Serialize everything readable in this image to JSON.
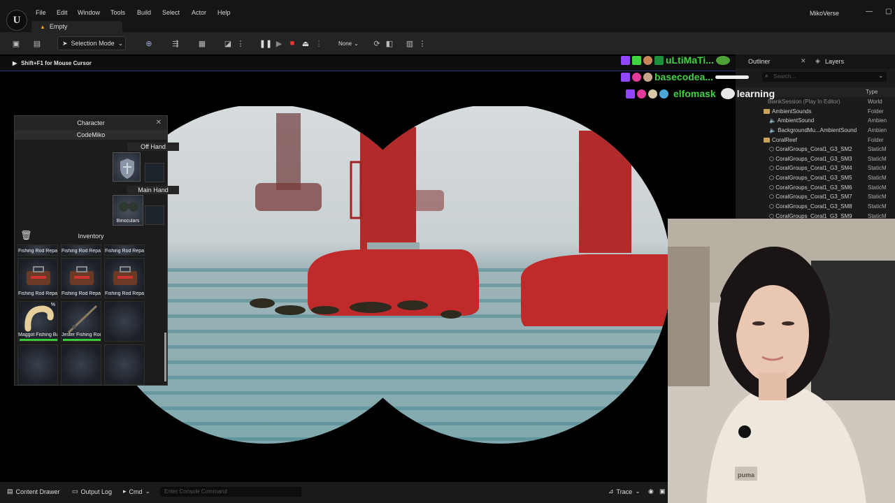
{
  "menu": [
    "File",
    "Edit",
    "Window",
    "Tools",
    "Build",
    "Select",
    "Actor",
    "Help"
  ],
  "project_tab": "Empty",
  "app_name": "MikoVerse",
  "toolbar": {
    "selection_mode": "Selection Mode",
    "play_target": "None"
  },
  "hint": "Shift+F1 for Mouse Cursor",
  "character_panel": {
    "title": "Character",
    "name": "CodeMiko",
    "off_hand": "Off Hand",
    "main_hand": "Main Hand",
    "main_hand_item": "Binoculars",
    "inventory_title": "Inventory",
    "inventory": [
      "Fishing Rod Repair",
      "Fishing Rod Repair",
      "Fishing Rod Repair",
      "Fishing Rod Repair",
      "Fishing Rod Repair",
      "Fishing Rod Repair",
      "Maggot Fishing Bait",
      "Jester Fishing Rod",
      "",
      "",
      "",
      ""
    ],
    "bait_count": "%"
  },
  "chat": [
    {
      "name": "uLtiMaTi...",
      "color": "#3fd33f"
    },
    {
      "name": "basecodea...",
      "color": "#3fd33f"
    },
    {
      "name": "elfomask",
      "color": "#3fd33f",
      "message": "learning"
    }
  ],
  "outliner": {
    "tab_outliner": "Outliner",
    "tab_layers": "Layers",
    "search_placeholder": "Search...",
    "type_header": "Type",
    "rows": [
      {
        "name": "BlankSession (Play In Editor)",
        "type": "World"
      },
      {
        "name": "AmbientSounds",
        "type": "Folder"
      },
      {
        "name": "AmbientSound",
        "type": "Ambien"
      },
      {
        "name": "BackgroundMu...AmbientSound",
        "type": "Ambien"
      },
      {
        "name": "CoralReef",
        "type": "Folder"
      },
      {
        "name": "CoralGroups_Coral1_G3_SM2",
        "type": "StaticM"
      },
      {
        "name": "CoralGroups_Coral1_G3_SM3",
        "type": "StaticM"
      },
      {
        "name": "CoralGroups_Coral1_G3_SM4",
        "type": "StaticM"
      },
      {
        "name": "CoralGroups_Coral1_G3_SM5",
        "type": "StaticM"
      },
      {
        "name": "CoralGroups_Coral1_G3_SM6",
        "type": "StaticM"
      },
      {
        "name": "CoralGroups_Coral1_G3_SM7",
        "type": "StaticM"
      },
      {
        "name": "CoralGroups_Coral1_G3_SM8",
        "type": "StaticM"
      },
      {
        "name": "CoralGroups_Coral1_G3_SM9",
        "type": "StaticM"
      }
    ]
  },
  "statusbar": {
    "content_drawer": "Content Drawer",
    "output_log": "Output Log",
    "cmd": "Cmd",
    "console_placeholder": "Enter Console Command",
    "trace": "Trace"
  },
  "webcam": {
    "shirt_logo": "puma"
  }
}
